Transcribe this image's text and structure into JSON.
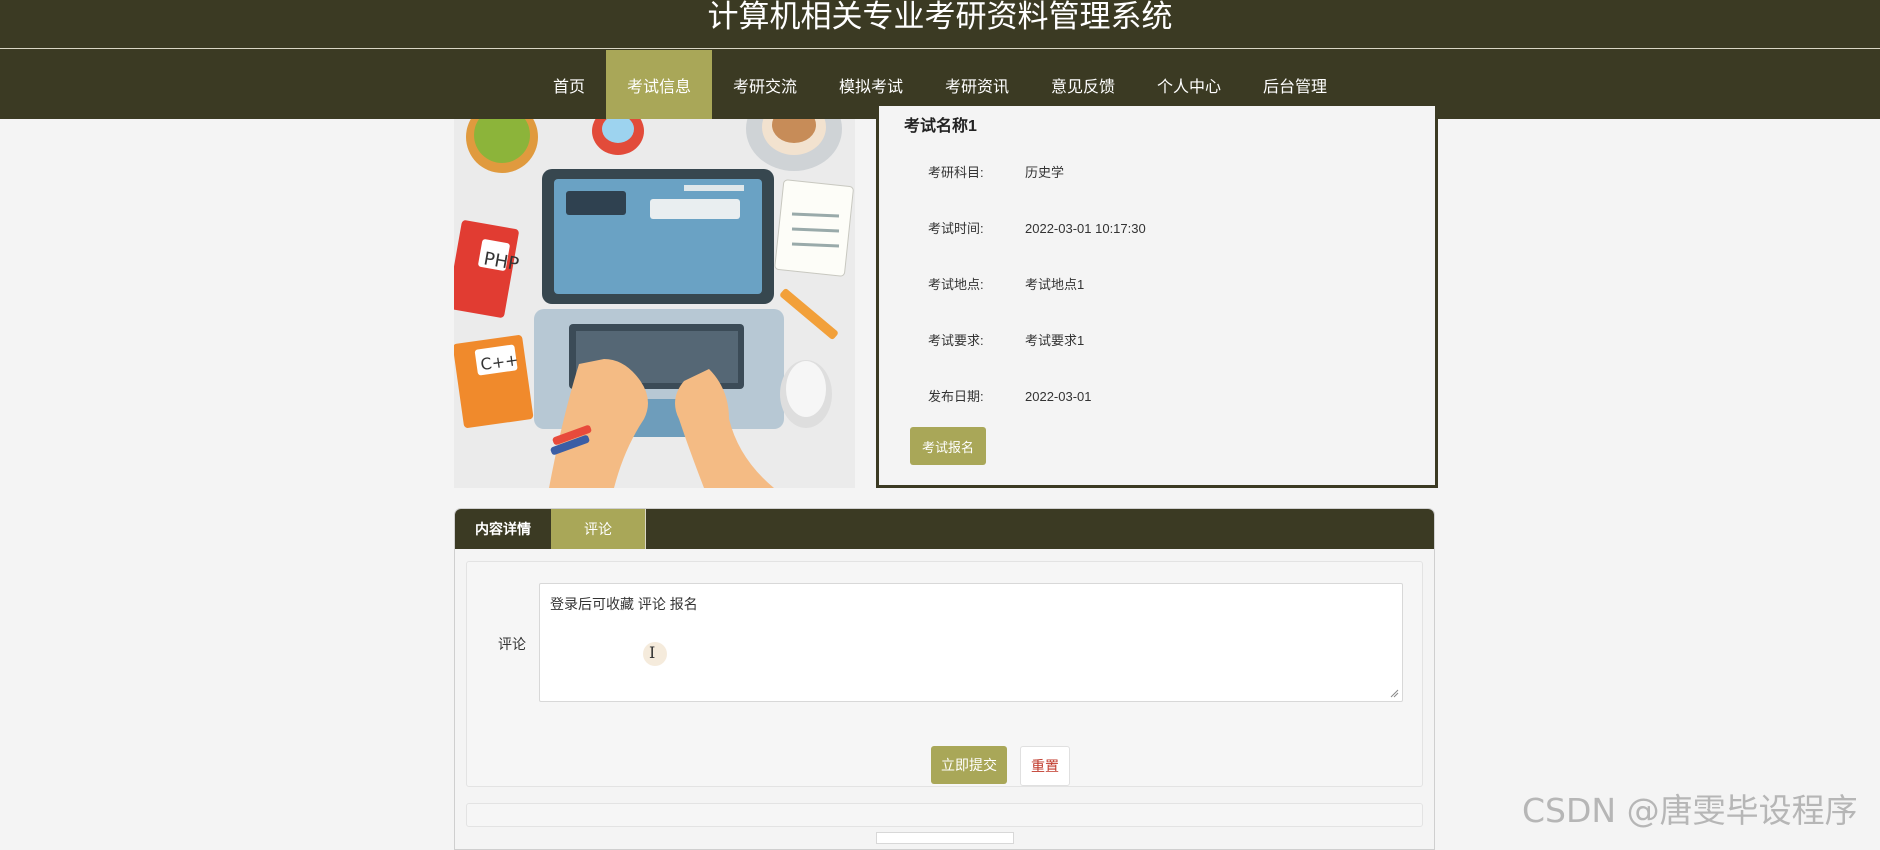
{
  "site": {
    "title": "计算机相关专业考研资料管理系统"
  },
  "nav": {
    "items": [
      {
        "label": "首页"
      },
      {
        "label": "考试信息"
      },
      {
        "label": "考研交流"
      },
      {
        "label": "模拟考试"
      },
      {
        "label": "考研资讯"
      },
      {
        "label": "意见反馈"
      },
      {
        "label": "个人中心"
      },
      {
        "label": "后台管理"
      }
    ],
    "active": "考试信息"
  },
  "hero": {
    "icon": "laptop-desk-illustration",
    "book_labels": [
      "PHP",
      "C++"
    ]
  },
  "exam": {
    "name": "考试名称1",
    "fields": [
      {
        "label": "考研科目:",
        "value": "历史学"
      },
      {
        "label": "考试时间:",
        "value": "2022-03-01 10:17:30"
      },
      {
        "label": "考试地点:",
        "value": "考试地点1"
      },
      {
        "label": "考试要求:",
        "value": "考试要求1"
      },
      {
        "label": "发布日期:",
        "value": "2022-03-01"
      }
    ],
    "apply_label": "考试报名"
  },
  "tabs": [
    {
      "label": "内容详情"
    },
    {
      "label": "评论"
    }
  ],
  "comment": {
    "label": "评论",
    "text": "登录后可收藏 评论 报名",
    "submit_label": "立即提交",
    "reset_label": "重置"
  },
  "watermark": "CSDN @唐雯毕设程序",
  "colors": {
    "header": "#3b3a23",
    "accent": "#a9a758",
    "reset_text": "#c0392b"
  }
}
